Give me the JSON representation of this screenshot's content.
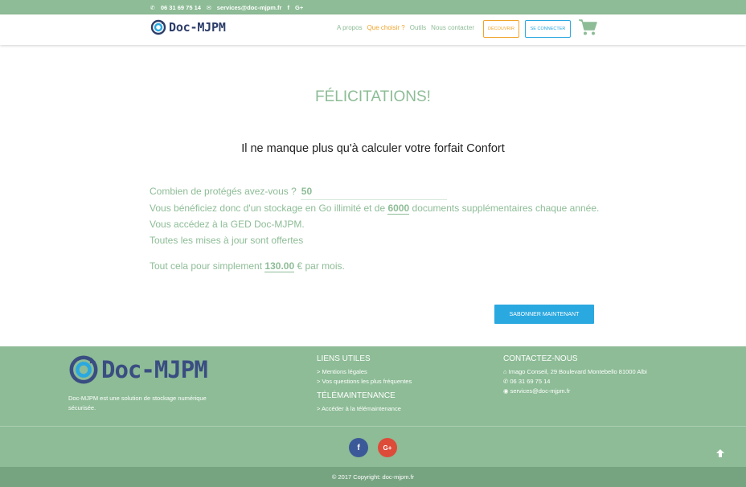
{
  "topbar": {
    "phone": "06 31 69 75 14",
    "email": "services@doc-mjpm.fr",
    "facebook": "f",
    "google": "G+"
  },
  "header": {
    "logo_text": "Doc-MJPM",
    "nav": [
      "A propos",
      "Que choisir ?",
      "Outils",
      "Nous contacter"
    ],
    "discover_button": "DÉCOUVRIR",
    "login_button": "SE CONNECTER"
  },
  "main": {
    "title": "FÉLICITATIONS!",
    "subtitle": "Il ne manque plus qu'à calculer votre forfait Confort",
    "question_label": "Combien de protégés avez-vous ?",
    "question_value": "50",
    "storage_prefix": "Vous bénéficiez donc d'un stockage en Go illimité et de",
    "storage_value": "6000",
    "storage_suffix": "documents supplémentaires chaque année.",
    "ged_line": "Vous accédez à la GED Doc-MJPM.",
    "updates_line": "Toutes les mises à jour sont offertes",
    "price_prefix": "Tout cela pour simplement",
    "price_value": "130.00",
    "price_suffix": "€ par mois.",
    "subscribe_button": "SABONNER MAINTENANT"
  },
  "footer": {
    "logo_text": "Doc-MJPM",
    "description": "Doc-MJPM est une solution de stockage numérique sécurisée.",
    "links_title": "LIENS UTILES",
    "links": [
      "> Mentions légales",
      "> Vos questions les plus fréquentes"
    ],
    "tele_title": "TÉLÉMAINTENANCE",
    "tele_link": "> Accéder à la télémaintenance",
    "contact_title": "CONTACTEZ-NOUS",
    "address": "Imago Conseil, 29 Boulevard Montebello 81000 Albi",
    "phone": "06 31 69 75 14",
    "email": "services@doc-mjpm.fr",
    "social_fb": "f",
    "social_gp": "G+",
    "copyright_prefix": "© 2017 Copyright:",
    "copyright_link": "doc-mjpm.fr"
  },
  "colors": {
    "green": "#8dbc96",
    "orange": "#f0a42b",
    "blue": "#2aa8e0",
    "navy": "#2d3e6a"
  }
}
